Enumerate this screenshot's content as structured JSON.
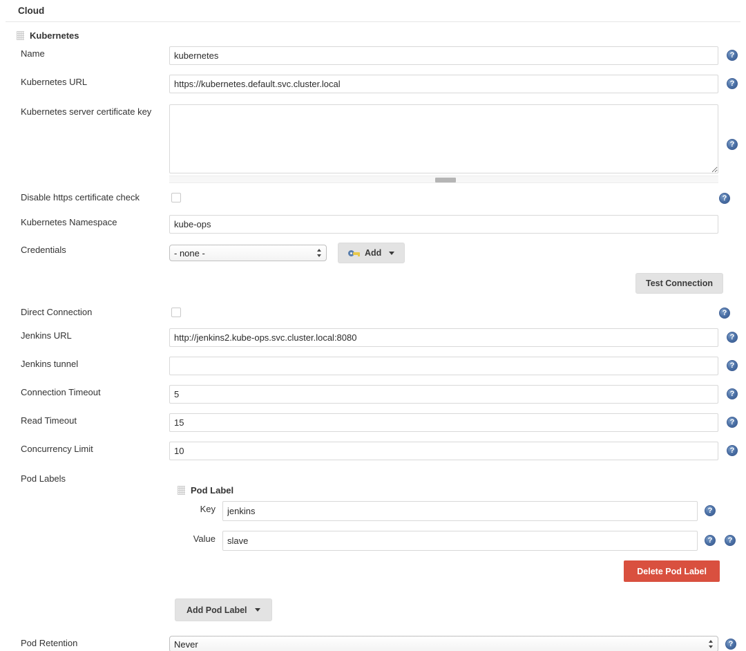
{
  "header": {
    "title": "Cloud"
  },
  "cloud": {
    "section_title": "Kubernetes",
    "drag_handle_icon": "drag-handle-icon",
    "fields": {
      "name": {
        "label": "Name",
        "value": "kubernetes",
        "help": "?"
      },
      "kubernetes_url": {
        "label": "Kubernetes URL",
        "value": "https://kubernetes.default.svc.cluster.local",
        "help": "?"
      },
      "server_certificate_key": {
        "label": "Kubernetes server certificate key",
        "value": "",
        "help": "?"
      },
      "disable_https_check": {
        "label": "Disable https certificate check",
        "checked": false,
        "help": "?"
      },
      "namespace": {
        "label": "Kubernetes Namespace",
        "value": "kube-ops"
      },
      "credentials": {
        "label": "Credentials",
        "selected": "- none -",
        "options": [
          "- none -"
        ],
        "add_button": "Add",
        "add_icon": "key-icon"
      },
      "test_connection": {
        "label": "Test Connection"
      },
      "direct_connection": {
        "label": "Direct Connection",
        "checked": false,
        "help": "?"
      },
      "jenkins_url": {
        "label": "Jenkins URL",
        "value": "http://jenkins2.kube-ops.svc.cluster.local:8080",
        "help": "?"
      },
      "jenkins_tunnel": {
        "label": "Jenkins tunnel",
        "value": "",
        "help": "?"
      },
      "connection_timeout": {
        "label": "Connection Timeout",
        "value": "5",
        "help": "?"
      },
      "read_timeout": {
        "label": "Read Timeout",
        "value": "15",
        "help": "?"
      },
      "concurrency_limit": {
        "label": "Concurrency Limit",
        "value": "10",
        "help": "?"
      },
      "pod_labels": {
        "label": "Pod Labels",
        "help": "?",
        "entry": {
          "title": "Pod Label",
          "drag_handle_icon": "drag-handle-icon",
          "key": {
            "label": "Key",
            "value": "jenkins",
            "help": "?"
          },
          "value": {
            "label": "Value",
            "value": "slave",
            "help": "?"
          },
          "delete_button": "Delete Pod Label"
        },
        "add_button": "Add Pod Label"
      },
      "pod_retention": {
        "label": "Pod Retention",
        "selected": "Never",
        "options": [
          "Never"
        ],
        "help": "?"
      }
    }
  },
  "colors": {
    "danger": "#d9503f",
    "button_bg": "#e3e3e3",
    "help_badge": "#4a6fa5",
    "border": "#d8d8d8"
  }
}
